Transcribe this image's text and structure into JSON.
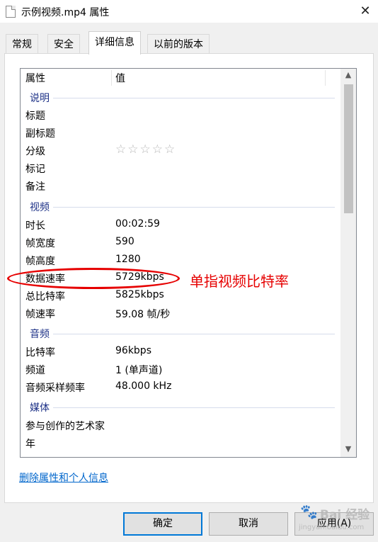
{
  "window": {
    "title": "示例视频.mp4 属性",
    "close_glyph": "✕"
  },
  "tabs": [
    {
      "label": "常规"
    },
    {
      "label": "安全"
    },
    {
      "label": "详细信息"
    },
    {
      "label": "以前的版本"
    }
  ],
  "list": {
    "col_property": "属性",
    "col_value": "值",
    "groups": {
      "description": "说明",
      "video": "视频",
      "audio": "音频",
      "media": "媒体"
    },
    "rows": {
      "title": {
        "key": "标题",
        "value": ""
      },
      "subtitle": {
        "key": "副标题",
        "value": ""
      },
      "rating": {
        "key": "分级",
        "value": "☆☆☆☆☆"
      },
      "tags": {
        "key": "标记",
        "value": ""
      },
      "comments": {
        "key": "备注",
        "value": ""
      },
      "length": {
        "key": "时长",
        "value": "00:02:59"
      },
      "frame_width": {
        "key": "帧宽度",
        "value": "590"
      },
      "frame_height": {
        "key": "帧高度",
        "value": "1280"
      },
      "data_rate": {
        "key": "数据速率",
        "value": "5729kbps"
      },
      "total_bitrate": {
        "key": "总比特率",
        "value": "5825kbps"
      },
      "frame_rate": {
        "key": "帧速率",
        "value": "59.08 帧/秒"
      },
      "bitrate": {
        "key": "比特率",
        "value": "96kbps"
      },
      "channels": {
        "key": "频道",
        "value": "1 (单声道)"
      },
      "sample_rate": {
        "key": "音频采样频率",
        "value": "48.000 kHz"
      },
      "contributing_artists": {
        "key": "参与创作的艺术家",
        "value": ""
      },
      "year": {
        "key": "年",
        "value": ""
      }
    }
  },
  "annotation": {
    "text": "单指视频比特率",
    "color": "#e60000"
  },
  "remove_link": "删除属性和个人信息",
  "buttons": {
    "ok": "确定",
    "cancel": "取消",
    "apply": "应用(A)"
  },
  "watermark": {
    "brand": "Bai 经验",
    "url": "jingyan.baidu.com"
  },
  "colors": {
    "accent": "#0078d7",
    "group_header": "#1e3287",
    "link": "#0066cc"
  }
}
